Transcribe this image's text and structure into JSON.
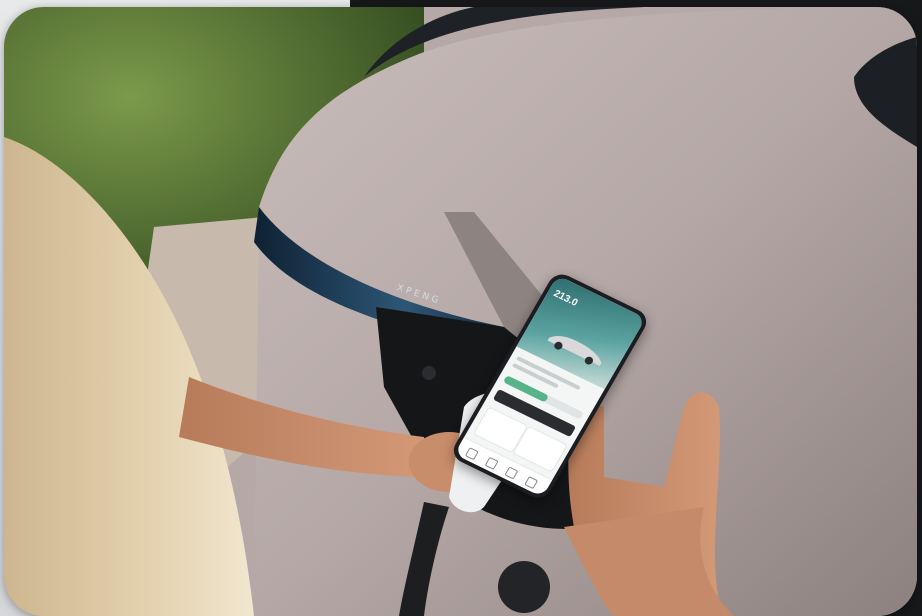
{
  "scene": {
    "car_badge_text": "XPENG",
    "phone_app": {
      "range_text": "213.0"
    }
  },
  "colors": {
    "car_body": "#b7aba9",
    "foliage": "#4d6a2e",
    "headlight": "#27425a",
    "charger": "#f1f1f2",
    "page_dark": "#17181a"
  },
  "icons": [
    "car-icon",
    "charging-connector"
  ]
}
